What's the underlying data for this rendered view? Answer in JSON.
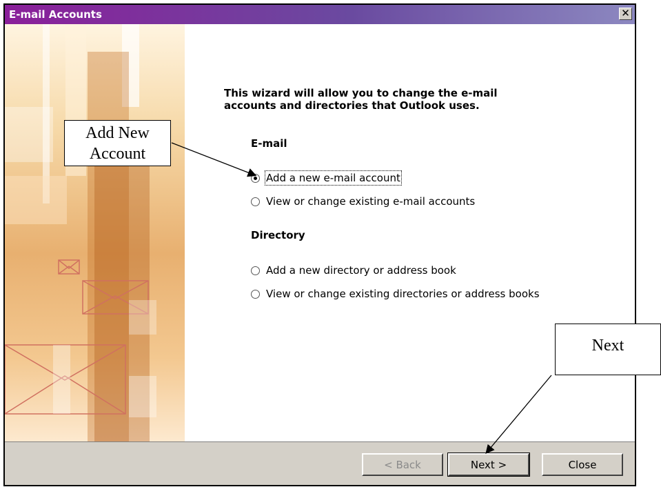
{
  "window": {
    "title": "E-mail Accounts",
    "close_glyph": "✕"
  },
  "wizard": {
    "intro_line1": "This wizard will allow you to change the e-mail",
    "intro_line2": "accounts and directories that Outlook uses.",
    "email_section": "E-mail",
    "email_options": [
      {
        "label": "Add a new e-mail account",
        "checked": true
      },
      {
        "label": "View or change existing e-mail accounts",
        "checked": false
      }
    ],
    "directory_section": "Directory",
    "directory_options": [
      {
        "label": "Add a new directory or address book",
        "checked": false
      },
      {
        "label": "View or change existing directories or address books",
        "checked": false
      }
    ]
  },
  "footer": {
    "back_label": "< Back",
    "next_label": "Next >",
    "close_label": "Close"
  },
  "callouts": {
    "add_new_account_line1": "Add New",
    "add_new_account_line2": "Account",
    "next": "Next"
  },
  "colors": {
    "titlebar_start": "#8a1f9a",
    "titlebar_end": "#8c88c0",
    "dialog_face": "#d4d0c8"
  }
}
